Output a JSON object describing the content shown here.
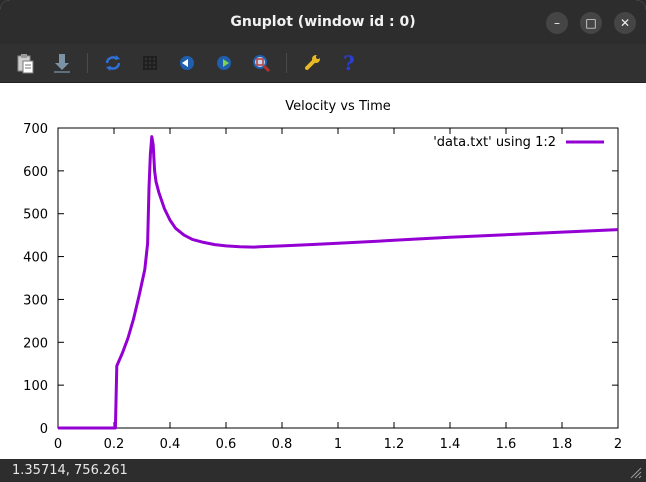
{
  "window": {
    "title": "Gnuplot (window id : 0)"
  },
  "window_controls": {
    "minimize": "–",
    "maximize": "□",
    "close": "✕"
  },
  "toolbar": {
    "buttons": [
      {
        "name": "copy-to-clipboard",
        "icon": "clipboard-icon"
      },
      {
        "name": "export",
        "icon": "download-icon"
      },
      {
        "name": "replot",
        "icon": "replot-icon"
      },
      {
        "name": "grid",
        "icon": "grid-icon"
      },
      {
        "name": "previous-zoom",
        "icon": "zoom-back-icon"
      },
      {
        "name": "next-zoom",
        "icon": "zoom-forward-icon"
      },
      {
        "name": "autoscale",
        "icon": "autoscale-icon"
      },
      {
        "name": "settings",
        "icon": "wrench-icon"
      },
      {
        "name": "help",
        "icon": "help-icon",
        "label": "?"
      }
    ]
  },
  "chart_data": {
    "type": "line",
    "title": "Velocity vs Time",
    "xlabel": "",
    "ylabel": "",
    "xlim": [
      0,
      2
    ],
    "ylim": [
      0,
      700
    ],
    "x_ticks": [
      "0",
      "0.2",
      "0.4",
      "0.6",
      "0.8",
      "1",
      "1.2",
      "1.4",
      "1.6",
      "1.8",
      "2"
    ],
    "y_ticks": [
      "0",
      "100",
      "200",
      "300",
      "400",
      "500",
      "600",
      "700"
    ],
    "grid": false,
    "legend_position": "top-right",
    "series": [
      {
        "name": "'data.txt' using 1:2",
        "color": "#9400d3",
        "points": [
          [
            0,
            0
          ],
          [
            0.2,
            0
          ],
          [
            0.205,
            0
          ],
          [
            0.21,
            145
          ],
          [
            0.23,
            175
          ],
          [
            0.25,
            210
          ],
          [
            0.27,
            255
          ],
          [
            0.29,
            310
          ],
          [
            0.31,
            370
          ],
          [
            0.32,
            430
          ],
          [
            0.325,
            560
          ],
          [
            0.33,
            640
          ],
          [
            0.335,
            680
          ],
          [
            0.34,
            660
          ],
          [
            0.345,
            600
          ],
          [
            0.35,
            575
          ],
          [
            0.36,
            550
          ],
          [
            0.38,
            512
          ],
          [
            0.4,
            485
          ],
          [
            0.42,
            466
          ],
          [
            0.45,
            450
          ],
          [
            0.48,
            440
          ],
          [
            0.52,
            433
          ],
          [
            0.56,
            428
          ],
          [
            0.6,
            425
          ],
          [
            0.65,
            423
          ],
          [
            0.7,
            422
          ],
          [
            0.72,
            423
          ],
          [
            0.8,
            425
          ],
          [
            0.9,
            428
          ],
          [
            1.0,
            431
          ],
          [
            1.2,
            438
          ],
          [
            1.4,
            445
          ],
          [
            1.6,
            451
          ],
          [
            1.8,
            457
          ],
          [
            2.0,
            463
          ]
        ]
      }
    ]
  },
  "status": {
    "coordinates": "1.35714,  756.261"
  }
}
